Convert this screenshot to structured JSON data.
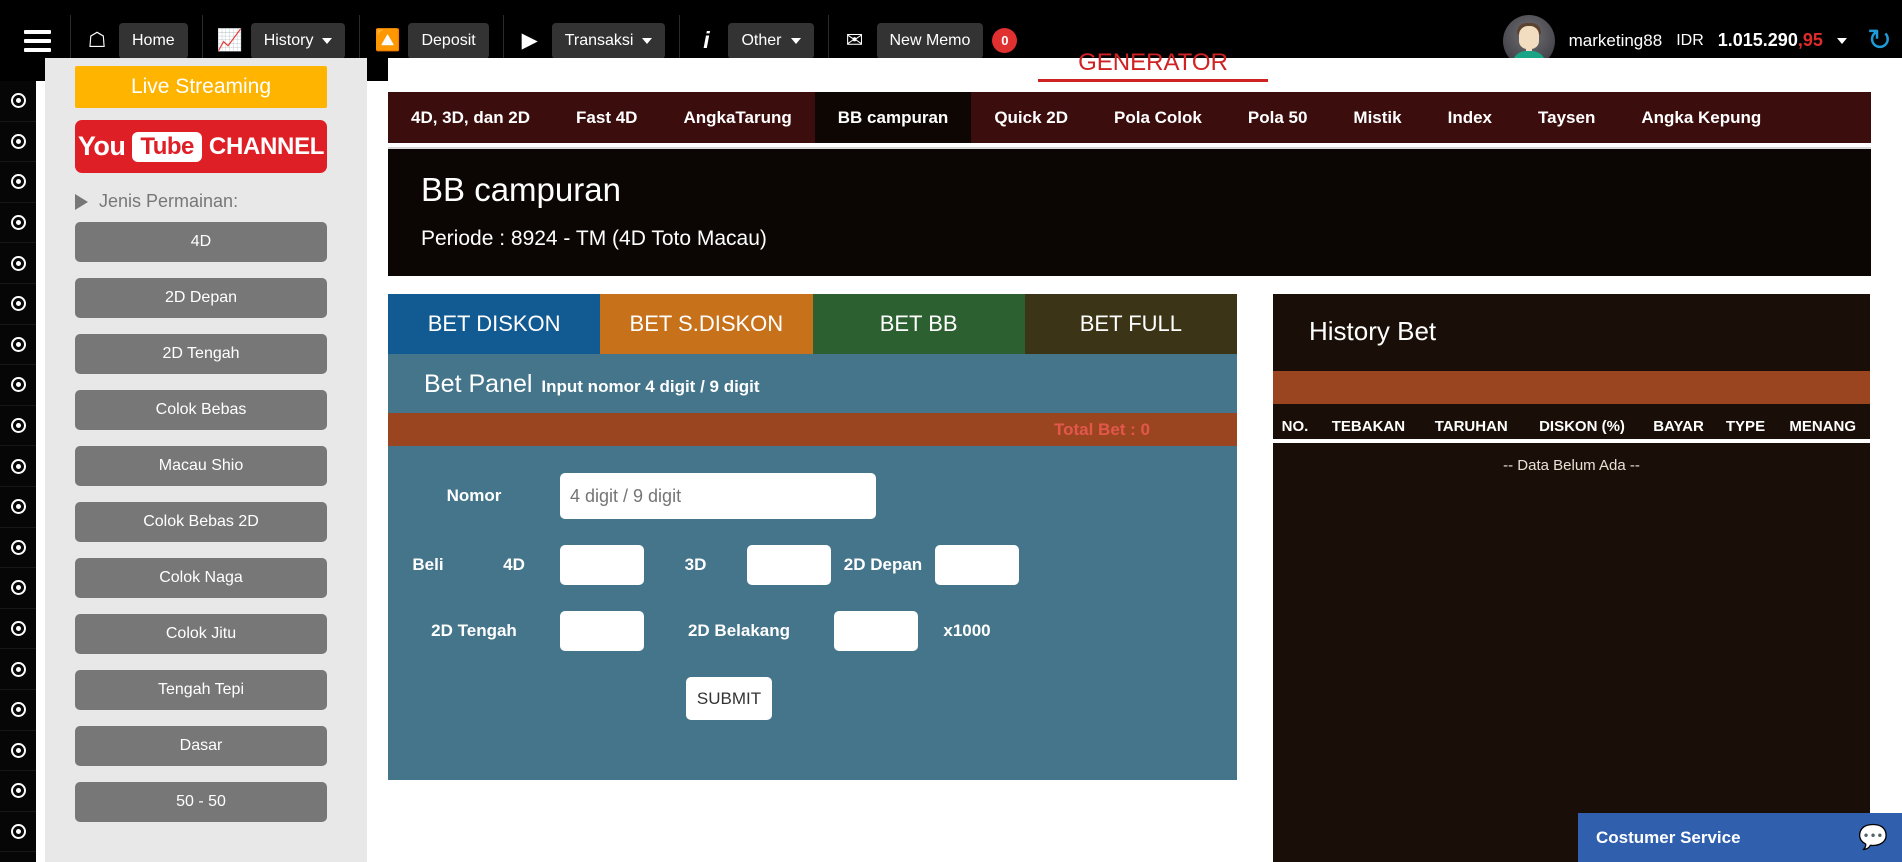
{
  "topbar": {
    "menu_icon": "hamburger-icon",
    "items": [
      {
        "icon": "home-icon",
        "glyph": "⌂",
        "label": "Home",
        "caret": false
      },
      {
        "icon": "chart-line-icon",
        "glyph": "Ὄ8",
        "label": "History",
        "caret": true
      },
      {
        "icon": "deposit-icon",
        "glyph": "●",
        "label": "Deposit",
        "caret": false
      },
      {
        "icon": "play-icon",
        "glyph": "▶",
        "label": "Transaksi",
        "caret": true
      },
      {
        "icon": "info-icon",
        "glyph": "i",
        "label": "Other",
        "caret": true
      },
      {
        "icon": "envelope-icon",
        "glyph": "✉",
        "label": "New Memo",
        "caret": false,
        "badge": "0"
      }
    ],
    "user": {
      "name": "marketing88",
      "currency": "IDR",
      "balance_whole": "1.015.290",
      "balance_cents": ",95",
      "caret": "▾",
      "refresh_icon": "refresh-icon"
    }
  },
  "rail": {
    "dot_count": 19
  },
  "sidebar": {
    "live_streaming": "Live Streaming",
    "youtube": {
      "you": "You",
      "tube": "Tube",
      "channel": "CHANNEL"
    },
    "jenis_label": "Jenis Permainan:",
    "games": [
      "4D",
      "2D Depan",
      "2D Tengah",
      "Colok Bebas",
      "Macau Shio",
      "Colok Bebas 2D",
      "Colok Naga",
      "Colok Jitu",
      "Tengah Tepi",
      "Dasar",
      "50 - 50"
    ]
  },
  "main": {
    "generator_label": "GENERATOR",
    "tabs": [
      "4D, 3D, dan 2D",
      "Fast 4D",
      "AngkaTarung",
      "BB campuran",
      "Quick 2D",
      "Pola Colok",
      "Pola 50",
      "Mistik",
      "Index",
      "Taysen",
      "Angka Kepung"
    ],
    "active_tab": "BB campuran",
    "title": "BB campuran",
    "periode": "Periode : 8924 - TM (4D Toto Macau)"
  },
  "bet": {
    "tabs": [
      {
        "label": "BET DISKON",
        "color": "#125a92"
      },
      {
        "label": "BET S.DISKON",
        "color": "#c8711b"
      },
      {
        "label": "BET BB",
        "color": "#2c6030"
      },
      {
        "label": "BET FULL",
        "color": "#3b3416"
      }
    ],
    "panel_title": "Bet Panel",
    "panel_subtitle": "Input nomor 4 digit / 9 digit",
    "total_bet": "Total Bet : 0",
    "nomor_label": "Nomor",
    "nomor_placeholder": "4 digit / 9 digit",
    "nomor_value": "",
    "beli_label": "Beli",
    "field_4d_label": "4D",
    "field_4d_value": "",
    "field_3d_label": "3D",
    "field_3d_value": "",
    "field_2ddepan_label": "2D Depan",
    "field_2ddepan_value": "",
    "field_2dtengah_label": "2D Tengah",
    "field_2dtengah_value": "",
    "field_2dbelakang_label": "2D Belakang",
    "field_2dbelakang_value": "",
    "multiplier_label": "x1000",
    "submit_label": "SUBMIT"
  },
  "history": {
    "title": "History Bet",
    "columns": [
      "NO.",
      "TEBAKAN",
      "TARUHAN",
      "DISKON (%)",
      "BAYAR",
      "TYPE",
      "MENANG"
    ],
    "empty_text": "-- Data Belum Ada --",
    "rows": []
  },
  "customer_service": {
    "label": "Costumer Service",
    "icon": "chat-bubble-icon"
  },
  "colors": {
    "topbar_bg": "#000000",
    "tabbar_bg": "#3b0d0d",
    "active_tab_bg": "#0d0603",
    "title_bg": "#0b0603",
    "bet_body": "#44758a",
    "accent_orange": "#9b4520",
    "history_bg": "#1a0f08",
    "cs_blue": "#2f5fad",
    "live_yellow": "#ffb400",
    "youtube_red": "#df1f26",
    "balance_cents_red": "#e02b2b",
    "generator_red": "#cf2222"
  }
}
